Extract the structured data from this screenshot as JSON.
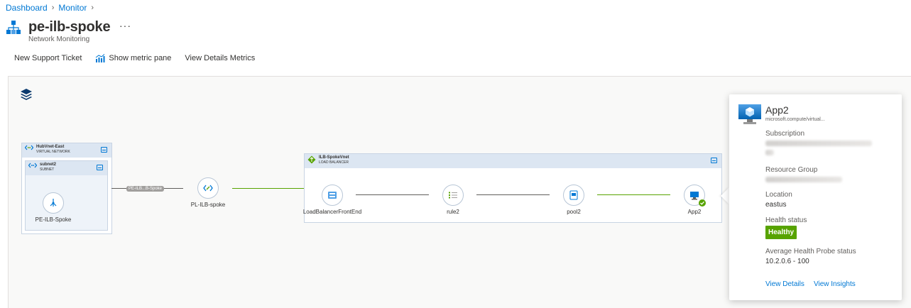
{
  "breadcrumb": {
    "items": [
      "Dashboard",
      "Monitor"
    ]
  },
  "header": {
    "title": "pe-ilb-spoke",
    "subtitle": "Network Monitoring",
    "more": "···"
  },
  "toolbar": {
    "new_support_ticket": "New Support Ticket",
    "show_metric_pane": "Show metric pane",
    "view_details_metrics": "View Details Metrics"
  },
  "topology": {
    "hub_group": {
      "name": "HubVnet-East",
      "type": "VIRTUAL NETWORK"
    },
    "subnet_group": {
      "name": "subnet2",
      "type": "SUBNET"
    },
    "lb_group": {
      "name": "ILB-SpokeVnet",
      "type": "LOAD BALANCER"
    },
    "edge_label": "PE-ILB...B-Spoke",
    "nodes": {
      "pe": "PE-ILB-Spoke",
      "pl": "PL-ILB-spoke",
      "frontend": "LoadBalancerFrontEnd",
      "rule": "rule2",
      "pool": "pool2",
      "app": "App2"
    }
  },
  "panel": {
    "title": "App2",
    "type": "microsoft.compute/virtual...",
    "subscription_label": "Subscription",
    "resource_group_label": "Resource Group",
    "location_label": "Location",
    "location_value": "eastus",
    "health_label": "Health status",
    "health_value": "Healthy",
    "probe_label": "Average Health Probe status",
    "probe_value": "10.2.0.6 - 100",
    "view_details": "View Details",
    "view_insights": "View Insights"
  },
  "colors": {
    "accent": "#0078d4",
    "healthy": "#57a300",
    "link_green": "#57a300"
  }
}
